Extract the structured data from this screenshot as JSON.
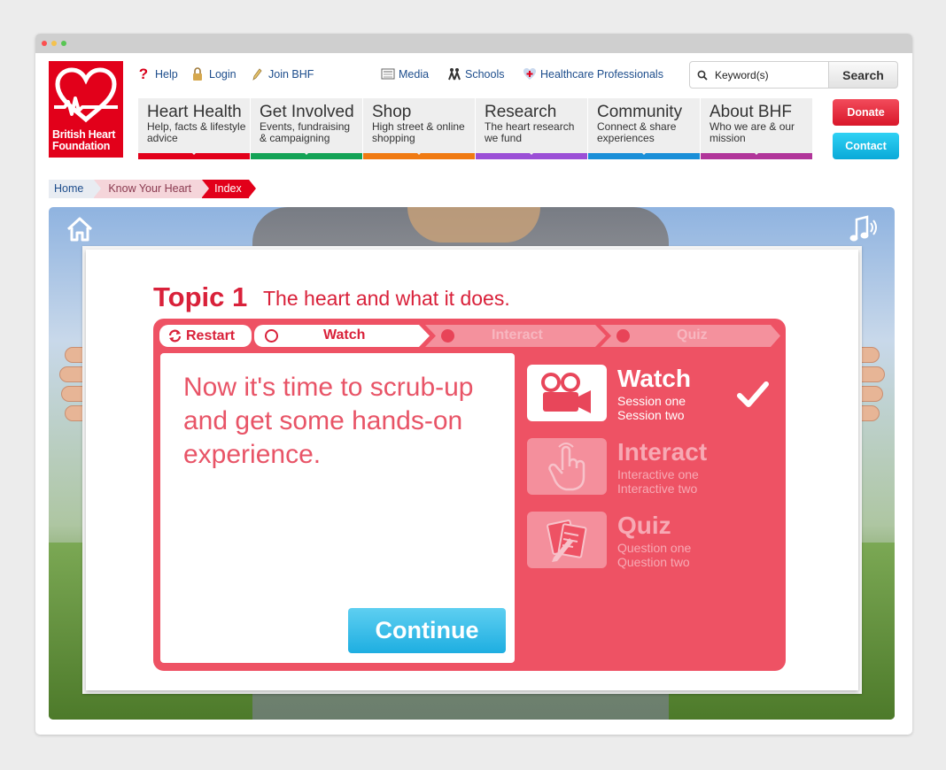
{
  "header": {
    "logo_text": "British Heart Foundation",
    "links": [
      "Help",
      "Login",
      "Join BHF",
      "Media",
      "Schools",
      "Healthcare Professionals"
    ],
    "search": {
      "placeholder": "Keyword(s)",
      "value": "Keyword(s)",
      "button": "Search"
    }
  },
  "nav": [
    {
      "title": "Heart Health",
      "sub": "Help, facts & lifestyle advice",
      "color": "#e2001a"
    },
    {
      "title": "Get Involved",
      "sub": "Events, fundraising & campaigning",
      "color": "#13a356"
    },
    {
      "title": "Shop",
      "sub": "High street & online shopping",
      "color": "#f07a12"
    },
    {
      "title": "Research",
      "sub": "The heart research we fund",
      "color": "#9b4fd6"
    },
    {
      "title": "Community",
      "sub": "Connect & share experiences",
      "color": "#1a8fd8"
    },
    {
      "title": "About BHF",
      "sub": "Who we are & our mission",
      "color": "#b1359a"
    }
  ],
  "side_buttons": {
    "donate": "Donate",
    "contact": "Contact"
  },
  "breadcrumb": [
    "Home",
    "Know Your Heart",
    "Index"
  ],
  "module": {
    "topic_number": "Topic 1",
    "topic_title": "The heart and what it does.",
    "tabs": {
      "restart": "Restart",
      "watch": "Watch",
      "interact": "Interact",
      "quiz": "Quiz"
    },
    "message": "Now it's time to scrub-up and get some hands-on experience.",
    "continue": "Continue",
    "steps": [
      {
        "title": "Watch",
        "sub1": "Session one",
        "sub2": "Session two",
        "icon": "video-camera-icon",
        "state": "complete"
      },
      {
        "title": "Interact",
        "sub1": "Interactive one",
        "sub2": "Interactive two",
        "icon": "pointing-hand-icon",
        "state": "locked"
      },
      {
        "title": "Quiz",
        "sub1": "Question one",
        "sub2": "Question two",
        "icon": "papers-pencil-icon",
        "state": "locked"
      }
    ]
  },
  "colors": {
    "brand_red": "#e2001a",
    "panel_pink": "#ee5264",
    "continue_blue": "#1eaee1"
  }
}
